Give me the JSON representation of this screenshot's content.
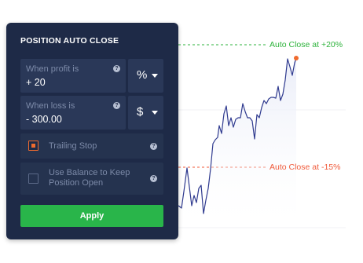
{
  "chart": {
    "take_profit_label": "Auto Close at +20%",
    "stop_loss_label": "Auto Close at -15%",
    "profit_color": "#2eb33c",
    "loss_color": "#f05a3a",
    "line_color": "#2f3a8f",
    "marker_color": "#f06b2e"
  },
  "panel": {
    "title": "POSITION AUTO CLOSE",
    "profit": {
      "label": "When profit is",
      "value": "+ 20",
      "unit": "%"
    },
    "loss": {
      "label": "When loss is",
      "value": "- 300.00",
      "unit": "$"
    },
    "help_glyph": "?",
    "trailing_stop": {
      "label": "Trailing Stop",
      "checked": true
    },
    "use_balance": {
      "label": "Use Balance to Keep Position Open",
      "checked": false
    },
    "apply_label": "Apply",
    "icons": [
      "help-icon",
      "chevron-down-icon",
      "checkbox-icon"
    ]
  }
}
